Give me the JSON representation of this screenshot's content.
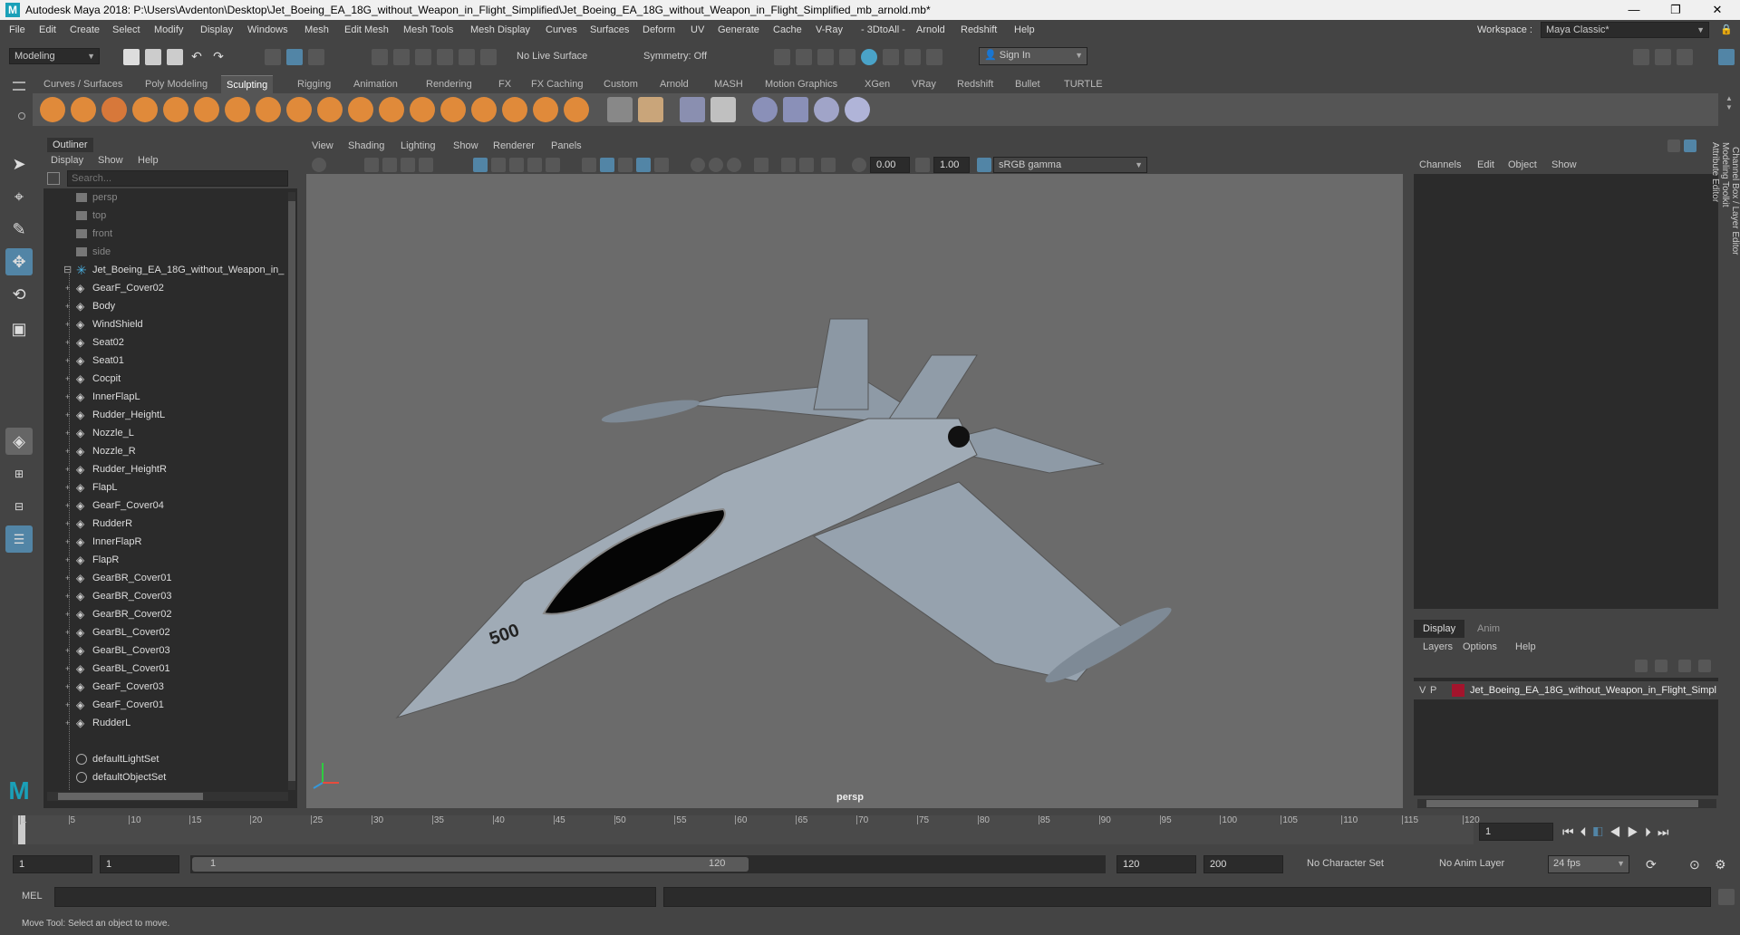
{
  "window": {
    "title": "Autodesk Maya 2018: P:\\Users\\Avdenton\\Desktop\\Jet_Boeing_EA_18G_without_Weapon_in_Flight_Simplified\\Jet_Boeing_EA_18G_without_Weapon_in_Flight_Simplified_mb_arnold.mb*",
    "minimize": "—",
    "maximize": "❐",
    "close": "✕"
  },
  "menubar": {
    "items": [
      "File",
      "Edit",
      "Create",
      "Select",
      "Modify",
      "Display",
      "Windows",
      "Mesh",
      "Edit Mesh",
      "Mesh Tools",
      "Mesh Display",
      "Curves",
      "Surfaces",
      "Deform",
      "UV",
      "Generate",
      "Cache",
      "V-Ray",
      "3DtoAll",
      "Arnold",
      "Redshift",
      "Help"
    ],
    "workspace_label": "Workspace :",
    "workspace_value": "Maya Classic*"
  },
  "statusline": {
    "mode": "Modeling",
    "live_surface": "No Live Surface",
    "symmetry": "Symmetry: Off",
    "sign_in": "Sign In"
  },
  "shelf": {
    "tabs": [
      "Curves / Surfaces",
      "Poly Modeling",
      "Sculpting",
      "Rigging",
      "Animation",
      "Rendering",
      "FX",
      "FX Caching",
      "Custom",
      "Arnold",
      "MASH",
      "Motion Graphics",
      "XGen",
      "VRay",
      "Redshift",
      "Bullet",
      "TURTLE"
    ],
    "active_tab": "Sculpting"
  },
  "outliner": {
    "title": "Outliner",
    "menu": [
      "Display",
      "Show",
      "Help"
    ],
    "search_placeholder": "Search...",
    "cameras": [
      "persp",
      "top",
      "front",
      "side"
    ],
    "root": "Jet_Boeing_EA_18G_without_Weapon_in_",
    "children": [
      "GearF_Cover02",
      "Body",
      "WindShield",
      "Seat02",
      "Seat01",
      "Cocpit",
      "InnerFlapL",
      "Rudder_HeightL",
      "Nozzle_L",
      "Nozzle_R",
      "Rudder_HeightR",
      "FlapL",
      "GearF_Cover04",
      "RudderR",
      "InnerFlapR",
      "FlapR",
      "GearBR_Cover01",
      "GearBR_Cover03",
      "GearBR_Cover02",
      "GearBL_Cover02",
      "GearBL_Cover03",
      "GearBL_Cover01",
      "GearF_Cover03",
      "GearF_Cover01",
      "RudderL"
    ],
    "sets": [
      "defaultLightSet",
      "defaultObjectSet"
    ]
  },
  "viewport": {
    "menu": [
      "View",
      "Shading",
      "Lighting",
      "Show",
      "Renderer",
      "Panels"
    ],
    "exposure": "0.00",
    "gamma": "1.00",
    "colorspace": "sRGB gamma",
    "camera_label": "persp",
    "aircraft_number": "500"
  },
  "channelbox": {
    "menu": [
      "Channels",
      "Edit",
      "Object",
      "Show"
    ],
    "side_tabs": [
      "Channel Box / Layer Editor",
      "Modeling Toolkit",
      "Attribute Editor"
    ],
    "layer_tabs": [
      "Display",
      "Anim"
    ],
    "layer_menu": [
      "Layers",
      "Options",
      "Help"
    ],
    "layer_v": "V",
    "layer_p": "P",
    "layer_name": "Jet_Boeing_EA_18G_without_Weapon_in_Flight_Simpl",
    "layer_color": "#a3142c"
  },
  "timeline": {
    "ticks": [
      "1",
      "5",
      "10",
      "15",
      "20",
      "25",
      "30",
      "35",
      "40",
      "45",
      "50",
      "55",
      "60",
      "65",
      "70",
      "75",
      "80",
      "85",
      "90",
      "95",
      "100",
      "105",
      "110",
      "115",
      "120"
    ],
    "current_frame": "1"
  },
  "range": {
    "start": "1",
    "start2": "1",
    "slider_start": "1",
    "slider_end": "120",
    "end": "120",
    "end2": "200",
    "character_set": "No Character Set",
    "anim_layer": "No Anim Layer",
    "fps": "24 fps"
  },
  "mel": {
    "label": "MEL"
  },
  "helpline": {
    "text": "Move Tool: Select an object to move."
  },
  "colors": {
    "accent": "#5285a6",
    "panel_dark": "#2b2b2b",
    "panel": "#444444",
    "viewport_bg": "#6b6b6b"
  }
}
